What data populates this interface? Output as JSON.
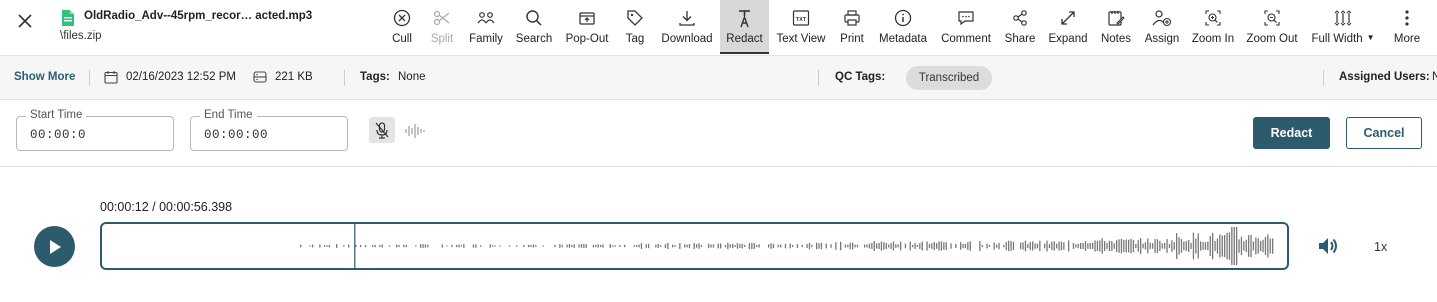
{
  "header": {
    "file_name": "OldRadio_Adv--45rpm_recor…  acted.mp3",
    "file_path": "\\files.zip"
  },
  "toolbar": [
    {
      "key": "cull",
      "label": "Cull",
      "icon": "cull-icon"
    },
    {
      "key": "split",
      "label": "Split",
      "icon": "scissors-icon",
      "disabled": true
    },
    {
      "key": "family",
      "label": "Family",
      "icon": "family-icon"
    },
    {
      "key": "search",
      "label": "Search",
      "icon": "search-icon"
    },
    {
      "key": "popout",
      "label": "Pop-Out",
      "icon": "pop-out-icon"
    },
    {
      "key": "tag",
      "label": "Tag",
      "icon": "tag-icon"
    },
    {
      "key": "download",
      "label": "Download",
      "icon": "download-icon"
    },
    {
      "key": "redact",
      "label": "Redact",
      "icon": "redact-icon",
      "active": true
    },
    {
      "key": "textview",
      "label": "Text View",
      "icon": "text-view-icon"
    },
    {
      "key": "print",
      "label": "Print",
      "icon": "print-icon"
    },
    {
      "key": "metadata",
      "label": "Metadata",
      "icon": "info-icon"
    },
    {
      "key": "comment",
      "label": "Comment",
      "icon": "comment-icon"
    },
    {
      "key": "share",
      "label": "Share",
      "icon": "share-icon"
    },
    {
      "key": "expand",
      "label": "Expand",
      "icon": "expand-icon"
    },
    {
      "key": "notes",
      "label": "Notes",
      "icon": "notes-icon"
    },
    {
      "key": "assign",
      "label": "Assign",
      "icon": "assign-user-icon"
    },
    {
      "key": "zoomin",
      "label": "Zoom In",
      "icon": "zoom-in-icon"
    },
    {
      "key": "zoomout",
      "label": "Zoom Out",
      "icon": "zoom-out-icon"
    },
    {
      "key": "fullwidth",
      "label": "Full Width",
      "icon": "full-width-icon"
    },
    {
      "key": "more",
      "label": "More",
      "icon": "more-vertical-icon"
    }
  ],
  "info": {
    "show_more": "Show More",
    "date": "02/16/2023 12:52 PM",
    "size": "221 KB",
    "tags_label": "Tags:",
    "tags_value": "None",
    "qc_tags_label": "QC Tags:",
    "qc_tag": "Transcribed",
    "assigned_users_label": "Assigned Users:",
    "assigned_users_value": "N"
  },
  "redact": {
    "start_label": "Start Time",
    "start_value": "00:00:0",
    "end_label": "End Time",
    "end_value": "00:00:00",
    "redact_button": "Redact",
    "cancel_button": "Cancel"
  },
  "player": {
    "current_time": "00:00:12",
    "separator": " / ",
    "duration": "00:00:56.398",
    "progress_fraction": 0.2128,
    "speed": "1x"
  },
  "colors": {
    "accent": "#2d5b6e",
    "wave": "#777777",
    "pill": "#dcdcdc"
  }
}
